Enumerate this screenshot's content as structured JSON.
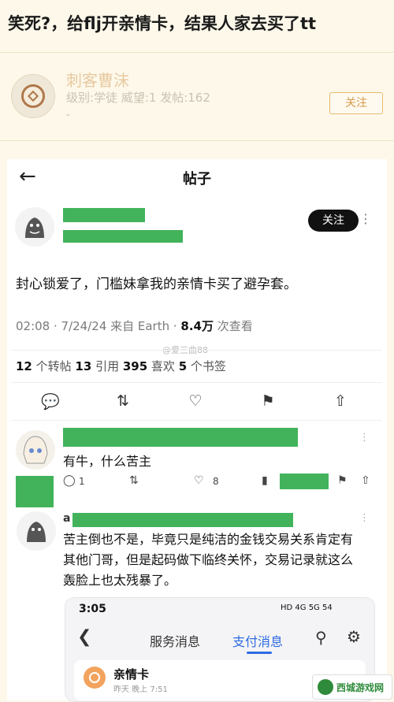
{
  "thread": {
    "title": "笑死?，给flj开亲情卡，结果人家去买了tt"
  },
  "poster": {
    "name": "刺客曹沫",
    "meta": "级别:学徒 威望:1 发帖:162",
    "dash": "-",
    "follow_label": "关注"
  },
  "screenshot": {
    "nav_title": "帖子",
    "follow_label": "关注",
    "post_text": "封心锁爱了，门槛妹拿我的亲情卡买了避孕套。",
    "meta_prefix": "02:08 · 7/24/24 来自 Earth · ",
    "meta_views": "8.4万",
    "meta_suffix": " 次查看",
    "watermark": "@爱三曲88",
    "stats": {
      "reposts_num": "12",
      "reposts_label": " 个转帖  ",
      "quotes_num": "13",
      "quotes_label": " 引用  ",
      "likes_num": "395",
      "likes_label": " 喜欢  ",
      "bookmarks_num": "5",
      "bookmarks_label": " 个书签"
    },
    "actions": {
      "reply_icon": "reply-icon",
      "retweet_icon": "retweet-icon",
      "like_icon": "heart-icon",
      "bookmark_icon": "bookmark-icon",
      "share_icon": "share-icon"
    },
    "comment1": {
      "text": "有牛，什么苦主",
      "reply_count": "1",
      "like_count": "8"
    },
    "comment2": {
      "letter": "a",
      "text": "苦主倒也不是，毕竟只是纯洁的金钱交易关系肯定有其他门哥，但是起码做下临终关怀，交易记录就这么轰脸上也太残暴了。"
    },
    "phone": {
      "time": "3:05",
      "status": "HD 4G 5G 54",
      "tab_service": "服务消息",
      "tab_payment": "支付消息",
      "card_title": "亲情卡",
      "card_sub": "昨天 晚上 7:51"
    }
  },
  "site_badge": {
    "label": "西城游戏网"
  },
  "colors": {
    "accent": "#d49a4a",
    "redaction": "#42b35b",
    "link_blue": "#2d6ae3"
  }
}
